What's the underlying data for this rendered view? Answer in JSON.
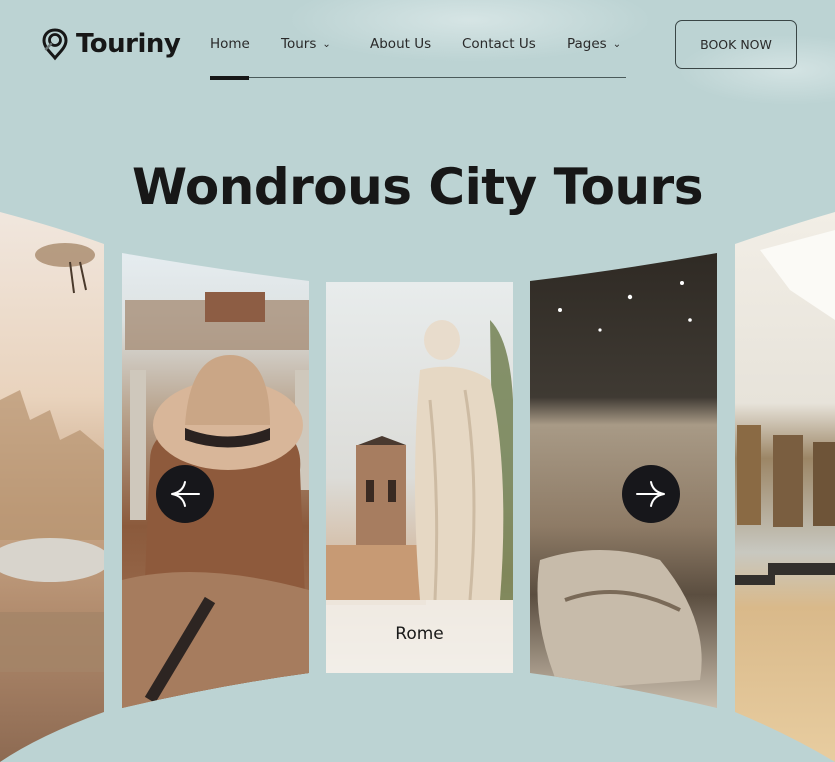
{
  "brand": {
    "name": "Touriny",
    "icon": "map-pin-search-icon"
  },
  "nav": {
    "items": [
      {
        "label": "Home",
        "active": true,
        "has_dropdown": false
      },
      {
        "label": "Tours",
        "active": false,
        "has_dropdown": true
      },
      {
        "label": "About Us",
        "active": false,
        "has_dropdown": false
      },
      {
        "label": "Contact Us",
        "active": false,
        "has_dropdown": false
      },
      {
        "label": "Pages",
        "active": false,
        "has_dropdown": true
      }
    ],
    "cta_label": "BOOK NOW"
  },
  "hero": {
    "title": "Wondrous City Tours"
  },
  "carousel": {
    "prev_icon": "arrow-left-icon",
    "next_icon": "arrow-right-icon",
    "cards": [
      {
        "name": "seagull-city",
        "label": ""
      },
      {
        "name": "traveler-ruins",
        "label": ""
      },
      {
        "name": "rome-statue",
        "label": "Rome"
      },
      {
        "name": "stone-museum",
        "label": ""
      },
      {
        "name": "art-gallery",
        "label": ""
      }
    ]
  },
  "colors": {
    "background": "#bcd3d3",
    "text": "#171717",
    "button_dark": "#17171b"
  }
}
